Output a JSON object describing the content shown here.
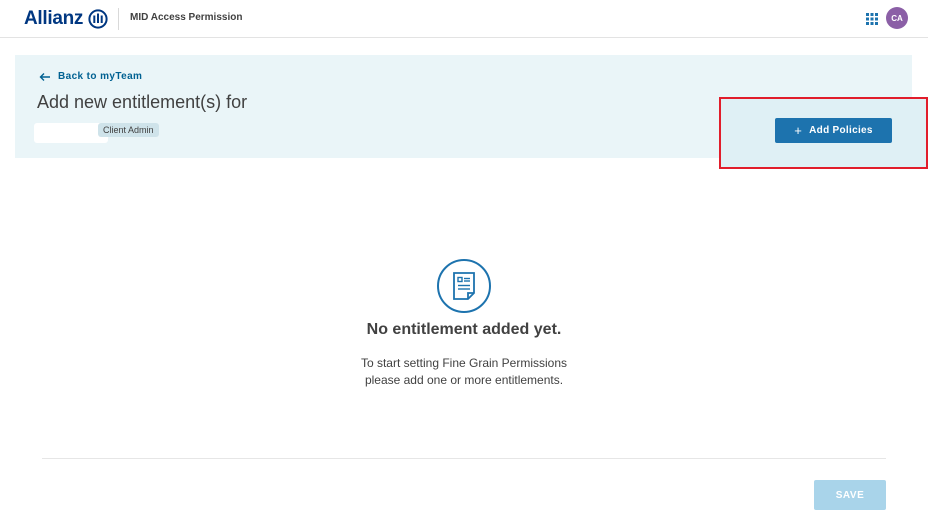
{
  "header": {
    "logo_text": "Allianz",
    "app_title": "MID Access Permission",
    "apps_icon": "grid-apps-icon",
    "avatar_initials": "CA",
    "avatar_color": "#8b5fa6"
  },
  "banner": {
    "back_label": "Back to myTeam",
    "title": "Add new entitlement(s) for",
    "role_badge": "Client Admin",
    "add_button_label": "Add Policies"
  },
  "empty_state": {
    "icon": "document-list-icon",
    "title": "No entitlement added yet.",
    "line1": "To start setting Fine Grain Permissions",
    "line2": "please add one or more entitlements."
  },
  "footer": {
    "save_label": "SAVE"
  },
  "colors": {
    "brand": "#003781",
    "primary": "#1d73ae",
    "banner_bg": "#eaf5f8",
    "highlight": "#e11d2b",
    "disabled_button": "#a9d4ea"
  }
}
